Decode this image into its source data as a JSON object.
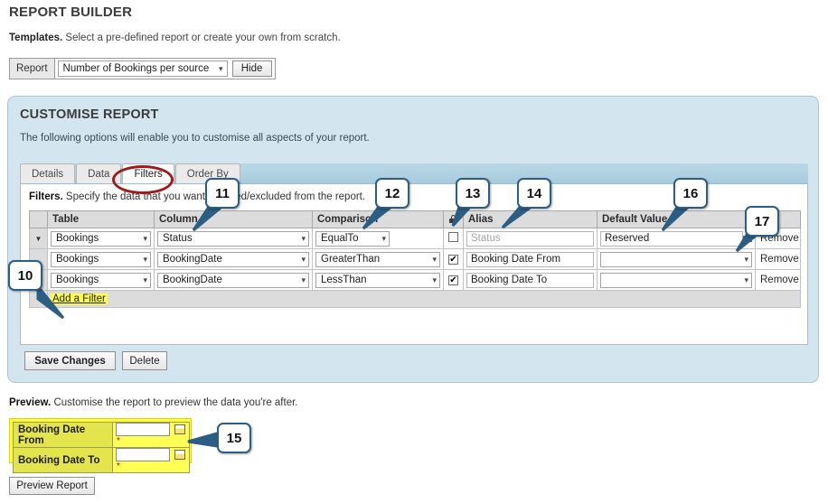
{
  "header": {
    "title": "REPORT BUILDER",
    "templates_label": "Templates.",
    "templates_text": " Select a pre-defined report or create your own from scratch.",
    "report_label": "Report",
    "report_select_value": "Number of Bookings per source",
    "hide_button": "Hide"
  },
  "panel": {
    "title": "CUSTOMISE REPORT",
    "subtitle": "The following options will enable you to customise all aspects of your report.",
    "tabs": [
      {
        "label": "Details",
        "active": false
      },
      {
        "label": "Data",
        "active": false
      },
      {
        "label": "Filters",
        "active": true
      },
      {
        "label": "Order By",
        "active": false
      }
    ],
    "filters_label": "Filters.",
    "filters_text": " Specify the data that you want included/excluded from the report.",
    "columns": [
      "",
      "Table",
      "Column",
      "Comparison",
      "lock-icon",
      "Alias",
      "Default Value",
      ""
    ],
    "rows": [
      {
        "expander": "▼",
        "table": "Bookings",
        "column": "Status",
        "comparison": "EqualTo",
        "checked": false,
        "alias": "Status",
        "alias_is_placeholder": true,
        "default_value": "Reserved",
        "default_is_text": true,
        "remove": "Remove"
      },
      {
        "expander": "",
        "table": "Bookings",
        "column": "BookingDate",
        "comparison": "GreaterThan",
        "checked": true,
        "alias": "Booking Date From",
        "alias_is_placeholder": false,
        "default_value": "",
        "default_is_text": false,
        "remove": "Remove"
      },
      {
        "expander": "▲",
        "table": "Bookings",
        "column": "BookingDate",
        "comparison": "LessThan",
        "checked": true,
        "alias": "Booking Date To",
        "alias_is_placeholder": false,
        "default_value": "",
        "default_is_text": false,
        "remove": "Remove"
      }
    ],
    "add_filter_link": "Add a Filter",
    "save_button": "Save Changes",
    "delete_button": "Delete"
  },
  "preview": {
    "label": "Preview.",
    "text": " Customise the report to preview the data you're after.",
    "fields": [
      {
        "label": "Booking Date From",
        "value": "",
        "required": "*"
      },
      {
        "label": "Booking Date To",
        "value": "",
        "required": "*"
      }
    ],
    "preview_button": "Preview Report"
  },
  "callouts": [
    {
      "id": "10",
      "number": "10"
    },
    {
      "id": "11",
      "number": "11"
    },
    {
      "id": "12",
      "number": "12"
    },
    {
      "id": "13",
      "number": "13"
    },
    {
      "id": "14",
      "number": "14"
    },
    {
      "id": "15",
      "number": "15"
    },
    {
      "id": "16",
      "number": "16"
    },
    {
      "id": "17",
      "number": "17"
    }
  ],
  "colors": {
    "panel_bg": "#d3e5ee",
    "tabstrip": "#b9d8e6",
    "highlight_yellow": "#ffff33",
    "callout_border": "#2c5d82",
    "annotation_red": "#9e1b1b"
  }
}
